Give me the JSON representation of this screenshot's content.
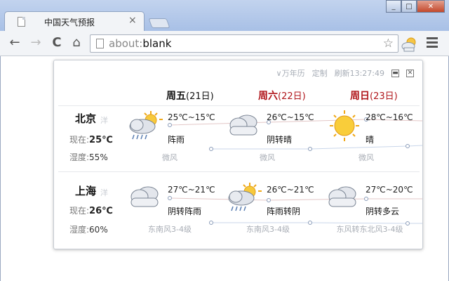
{
  "browser": {
    "tab_title": "中国天气预报",
    "tab_close": "×",
    "url_scheme": "about:",
    "url_rest": "blank",
    "window_minimize": "_",
    "window_maximize": "□",
    "window_close": "✕"
  },
  "toolbar": {
    "back": "←",
    "forward": "→",
    "reload": "C",
    "home": "⌂",
    "star": "☆"
  },
  "popup": {
    "calendar_link": "∨万年历",
    "customize_link": "定制",
    "refresh_label": "刷新",
    "refresh_time": "13:27:49",
    "days": [
      {
        "weekday": "周五",
        "date": "(21日)",
        "weekend": false
      },
      {
        "weekday": "周六",
        "date": "(22日)",
        "weekend": true
      },
      {
        "weekday": "周日",
        "date": "(23日)",
        "weekend": true
      }
    ],
    "cities": [
      {
        "name": "北京",
        "suffix": "洋",
        "now_label": "现在:",
        "now_value": "25℃",
        "humidity_label": "湿度:",
        "humidity_value": "55%",
        "forecast": [
          {
            "temp": "25℃~15℃",
            "condition": "阵雨",
            "wind": "微风",
            "icon": "sun-cloud-rain-icon"
          },
          {
            "temp": "26℃~15℃",
            "condition": "阴转晴",
            "wind": "微风",
            "icon": "cloud-icon"
          },
          {
            "temp": "28℃~16℃",
            "condition": "晴",
            "wind": "微风",
            "icon": "sun-icon"
          }
        ]
      },
      {
        "name": "上海",
        "suffix": "洋",
        "now_label": "现在:",
        "now_value": "26℃",
        "humidity_label": "湿度:",
        "humidity_value": "60%",
        "forecast": [
          {
            "temp": "27℃~21℃",
            "condition": "阴转阵雨",
            "wind": "东南风3-4级",
            "icon": "cloud-icon"
          },
          {
            "temp": "26℃~21℃",
            "condition": "阵雨转阴",
            "wind": "东南风3-4级",
            "icon": "sun-cloud-rain-icon"
          },
          {
            "temp": "27℃~20℃",
            "condition": "阴转多云",
            "wind": "东风转东北风3-4级",
            "icon": "cloud-icon"
          }
        ]
      }
    ]
  }
}
